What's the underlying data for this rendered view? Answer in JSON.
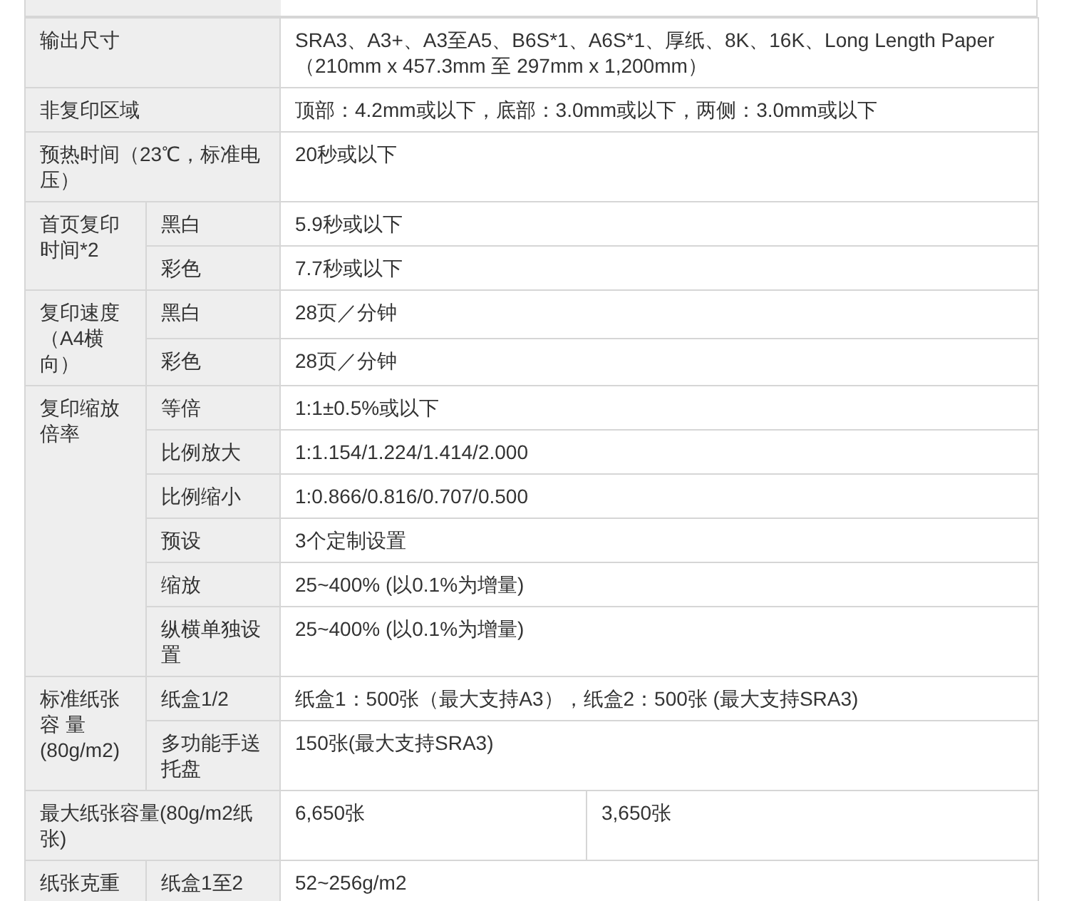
{
  "spec_table": {
    "rows": [
      {
        "label": "输出尺寸",
        "value": "SRA3、A3+、A3至A5、B6S*1、A6S*1、厚纸、8K、16K、Long Length Paper（210mm x 457.3mm 至 297mm x 1,200mm）"
      },
      {
        "label": "非复印区域",
        "value": "顶部：4.2mm或以下，底部：3.0mm或以下，两侧：3.0mm或以下"
      },
      {
        "label": "预热时间（23℃，标准电压）",
        "value": "20秒或以下"
      },
      {
        "label": "首页复印时间*2",
        "items": [
          {
            "label": "黑白",
            "value": "5.9秒或以下"
          },
          {
            "label": "彩色",
            "value": "7.7秒或以下"
          }
        ]
      },
      {
        "label": "复印速度（A4横向）",
        "items": [
          {
            "label": "黑白",
            "value": "28页／分钟"
          },
          {
            "label": "彩色",
            "value": "28页／分钟"
          }
        ]
      },
      {
        "label": "复印缩放倍率",
        "items": [
          {
            "label": "等倍",
            "value": "1:1±0.5%或以下"
          },
          {
            "label": "比例放大",
            "value": "1:1.154/1.224/1.414/2.000"
          },
          {
            "label": "比例缩小",
            "value": "1:0.866/0.816/0.707/0.500"
          },
          {
            "label": "预设",
            "value": "3个定制设置"
          },
          {
            "label": "缩放",
            "value": "25~400%  (以0.1%为增量)"
          },
          {
            "label": "纵横单独设置",
            "value": "25~400%  (以0.1%为增量)"
          }
        ]
      },
      {
        "label": "标准纸张容 量(80g/m2)",
        "items": [
          {
            "label": "纸盒1/2",
            "value": "纸盒1：500张（最大支持A3），纸盒2：500张 (最大支持SRA3)"
          },
          {
            "label": "多功能手送托盘",
            "value": "150张(最大支持SRA3)"
          }
        ]
      },
      {
        "label": "最大纸张容量(80g/m2纸张)",
        "values": [
          "6,650张",
          "3,650张"
        ]
      },
      {
        "label": "纸张克重",
        "items": [
          {
            "label": "纸盒1至2",
            "value": "52~256g/m2"
          }
        ]
      }
    ]
  }
}
